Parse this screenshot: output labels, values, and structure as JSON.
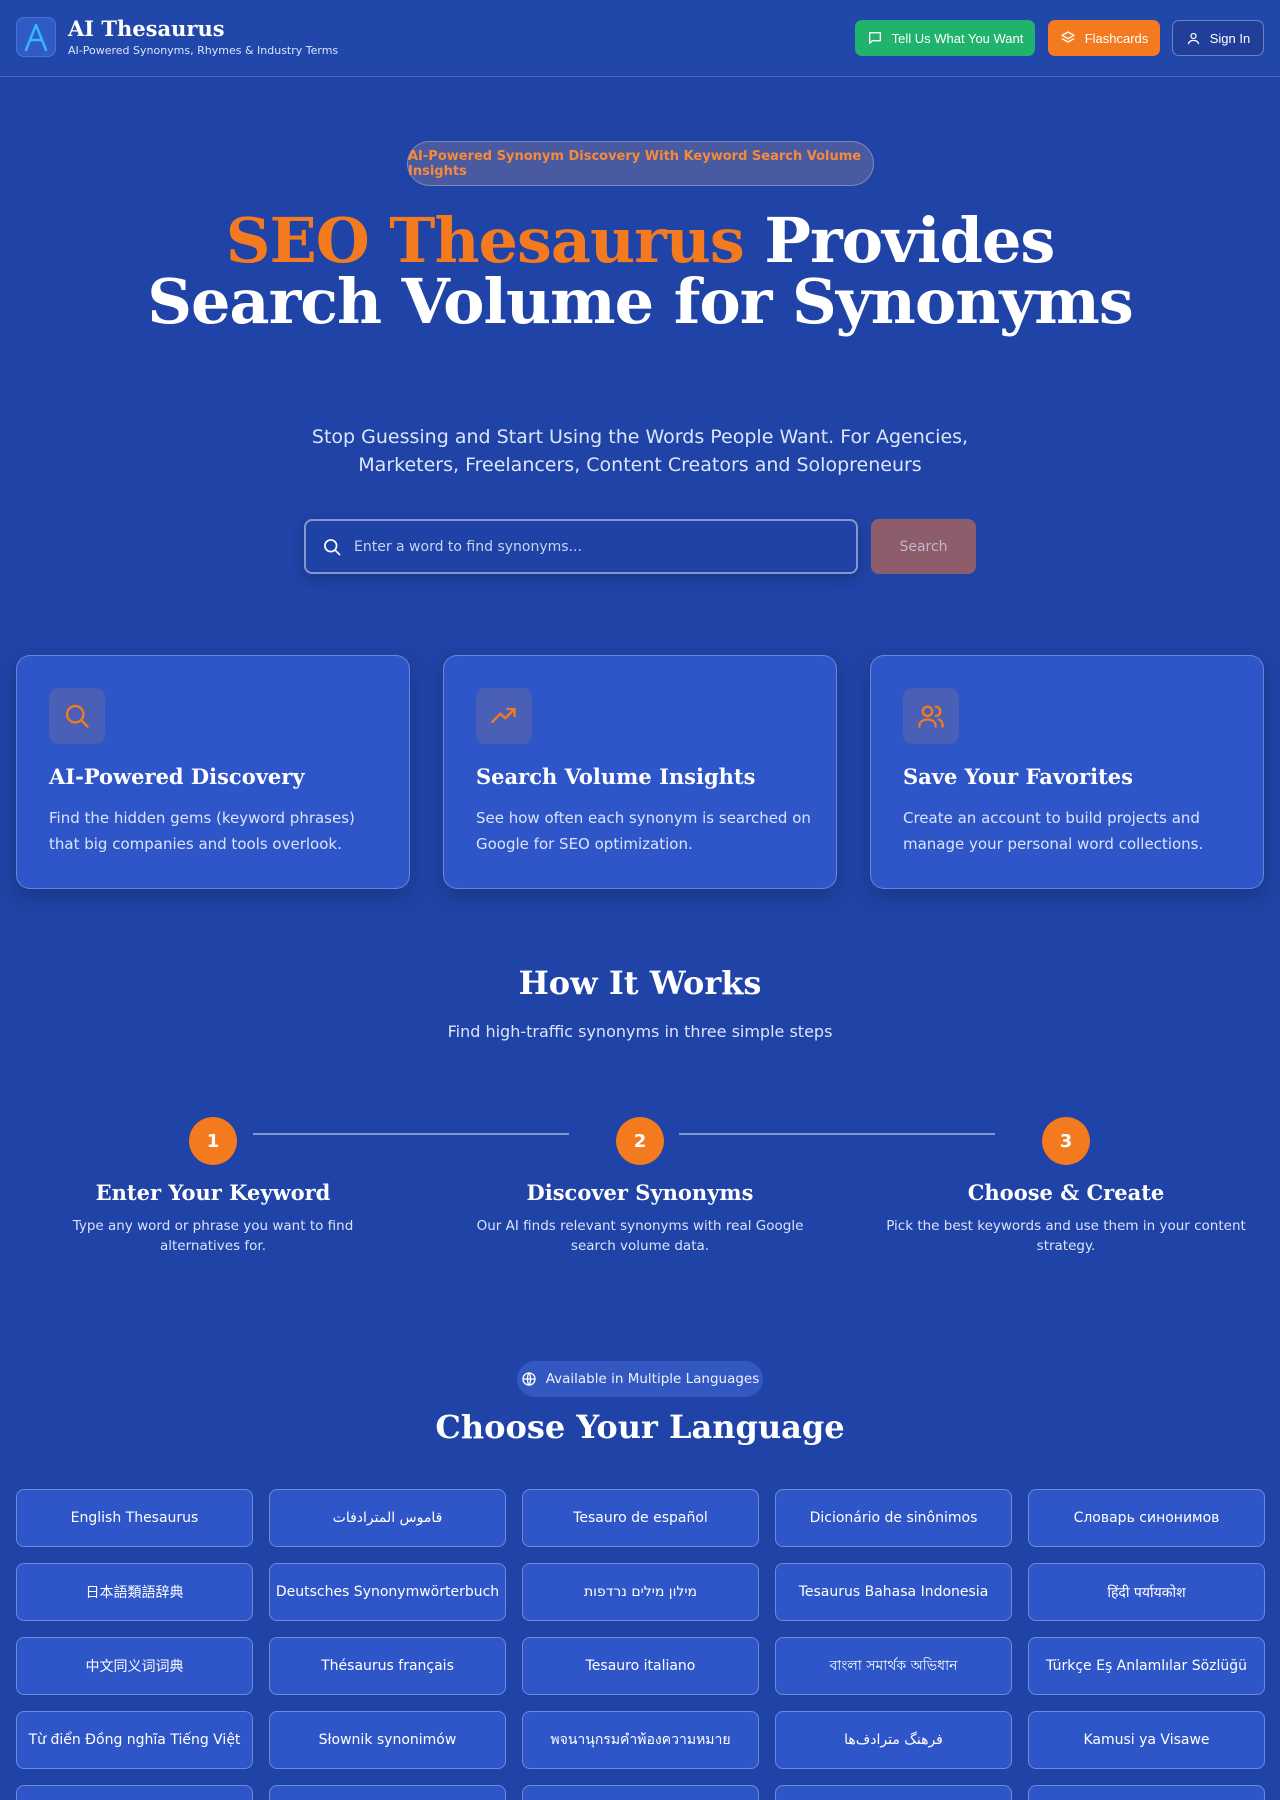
{
  "header": {
    "logo_letter": "A",
    "title": "AI Thesaurus",
    "subtitle": "AI-Powered Synonyms, Rhymes & Industry Terms",
    "buttons": {
      "feedback": "Tell Us What You Want",
      "flashcards": "Flashcards",
      "sign_in": "Sign In"
    }
  },
  "hero": {
    "badge": "AI-Powered Synonym Discovery With Keyword Search Volume Insights",
    "title_accent": "SEO Thesaurus",
    "title_rest": "Provides Search Volume for Synonyms",
    "subtitle": "Stop Guessing and Start Using the Words People Want. For Agencies, Marketers, Freelancers, Content Creators and Solopreneurs",
    "search_placeholder": "Enter a word to find synonyms...",
    "search_button": "Search"
  },
  "features": [
    {
      "icon": "search-icon",
      "title": "AI-Powered Discovery",
      "description": "Find the hidden gems (keyword phrases) that big companies and tools overlook."
    },
    {
      "icon": "trending-up-icon",
      "title": "Search Volume Insights",
      "description": "See how often each synonym is searched on Google for SEO optimization."
    },
    {
      "icon": "users-icon",
      "title": "Save Your Favorites",
      "description": "Create an account to build projects and manage your personal word collections."
    }
  ],
  "how_it_works": {
    "title": "How It Works",
    "subtitle": "Find high-traffic synonyms in three simple steps",
    "steps": [
      {
        "number": "1",
        "title": "Enter Your Keyword",
        "description": "Type any word or phrase you want to find alternatives for."
      },
      {
        "number": "2",
        "title": "Discover Synonyms",
        "description": "Our AI finds relevant synonyms with real Google search volume data."
      },
      {
        "number": "3",
        "title": "Choose & Create",
        "description": "Pick the best keywords and use them in your content strategy."
      }
    ]
  },
  "languages": {
    "badge": "Available in Multiple Languages",
    "title": "Choose Your Language",
    "items": [
      "English Thesaurus",
      "قاموس المترادفات",
      "Tesauro de español",
      "Dicionário de sinônimos",
      "Словарь синонимов",
      "日本語類語辞典",
      "Deutsches Synonymwörterbuch",
      "מילון מילים נרדפות",
      "Tesaurus Bahasa Indonesia",
      "हिंदी पर्यायकोश",
      "中文同义词词典",
      "Thésaurus français",
      "Tesauro italiano",
      "বাংলা সমার্থক অভিধান",
      "Türkçe Eş Anlamlılar Sözlüğü",
      "Từ điển Đồng nghĩa Tiếng Việt",
      "Słownik synonimów",
      "พจนานุกรมคำพ้องความหมาย",
      "فرهنگ مترادف‌ها",
      "Kamusi ya Visawe"
    ]
  },
  "colors": {
    "background": "#1f43a6",
    "accent_orange": "#f47a20",
    "accent_green": "#1fb36b",
    "card": "#2f56c8"
  }
}
